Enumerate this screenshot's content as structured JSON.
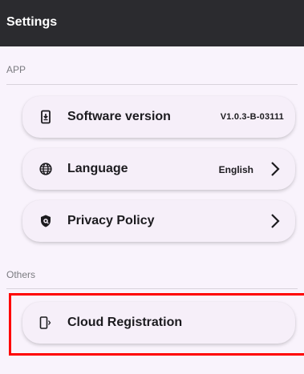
{
  "header": {
    "title": "Settings"
  },
  "sections": {
    "app": "APP",
    "others": "Others"
  },
  "items": {
    "software": {
      "label": "Software version",
      "value": "V1.0.3-B-03111",
      "icon": "phone-download-icon"
    },
    "language": {
      "label": "Language",
      "value": "English",
      "icon": "globe-icon"
    },
    "privacy": {
      "label": "Privacy Policy",
      "icon": "shield-icon"
    },
    "cloud": {
      "label": "Cloud Registration",
      "icon": "device-connect-icon"
    }
  },
  "colors": {
    "header_bg": "#2b2b2f",
    "page_bg": "#f9f3fc",
    "card_bg": "#f6eff9",
    "highlight": "#ff0000"
  }
}
